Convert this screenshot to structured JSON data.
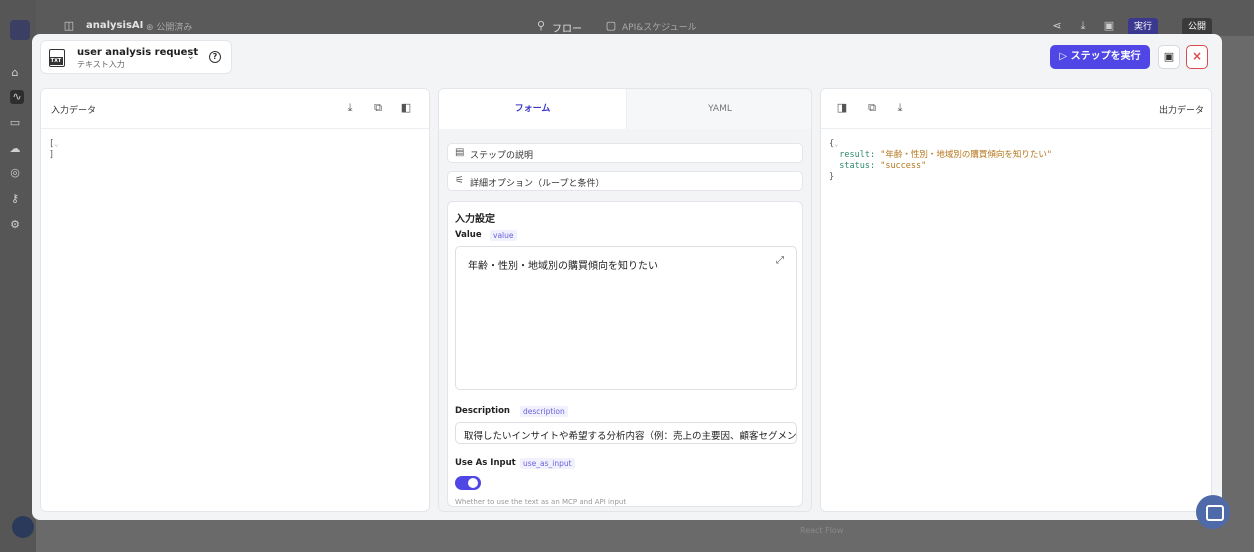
{
  "background": {
    "app_title": "analysisAI",
    "publish_state": "⊕ 公開済み",
    "flow_tab": "フロー",
    "api_tab": "API&スケジュール",
    "run_label": "実行",
    "publish_label": "公開",
    "bottom_text": "React Flow"
  },
  "header": {
    "step_name": "user analysis request",
    "step_type": "テキスト入力",
    "file_icon_text": "TXT",
    "run_step_label": "▷ ステップを実行"
  },
  "input_panel": {
    "title": "入力データ",
    "code_open": "[",
    "code_close": "]"
  },
  "tabs": {
    "form": "フォーム",
    "yaml": "YAML"
  },
  "form": {
    "step_description": "ステップの説明",
    "advanced_options": "詳細オプション（ループと条件）",
    "section_title": "入力設定",
    "value_label": "Value",
    "value_key": "value",
    "value_text": "年齢・性別・地域別の購買傾向を知りたい",
    "description_label": "Description",
    "description_key": "description",
    "description_text": "取得したいインサイトや希望する分析内容（例：売上の主要因、顧客セグメン",
    "use_as_input_label": "Use As Input",
    "use_as_input_key": "use_as_input",
    "use_as_input_on": true,
    "use_as_input_help": "Whether to use the text as an MCP and API input"
  },
  "output_panel": {
    "title": "出力データ",
    "code_open": "{",
    "result_key": "result:",
    "result_value": "\"年齢・性別・地域別の購買傾向を知りたい\"",
    "status_key": "status:",
    "status_value": "\"success\"",
    "code_close": "}"
  },
  "colors": {
    "accent": "#4f46e5",
    "close": "#dc4a4a",
    "json_key": "#2f8a6e",
    "json_string": "#b5751a"
  }
}
